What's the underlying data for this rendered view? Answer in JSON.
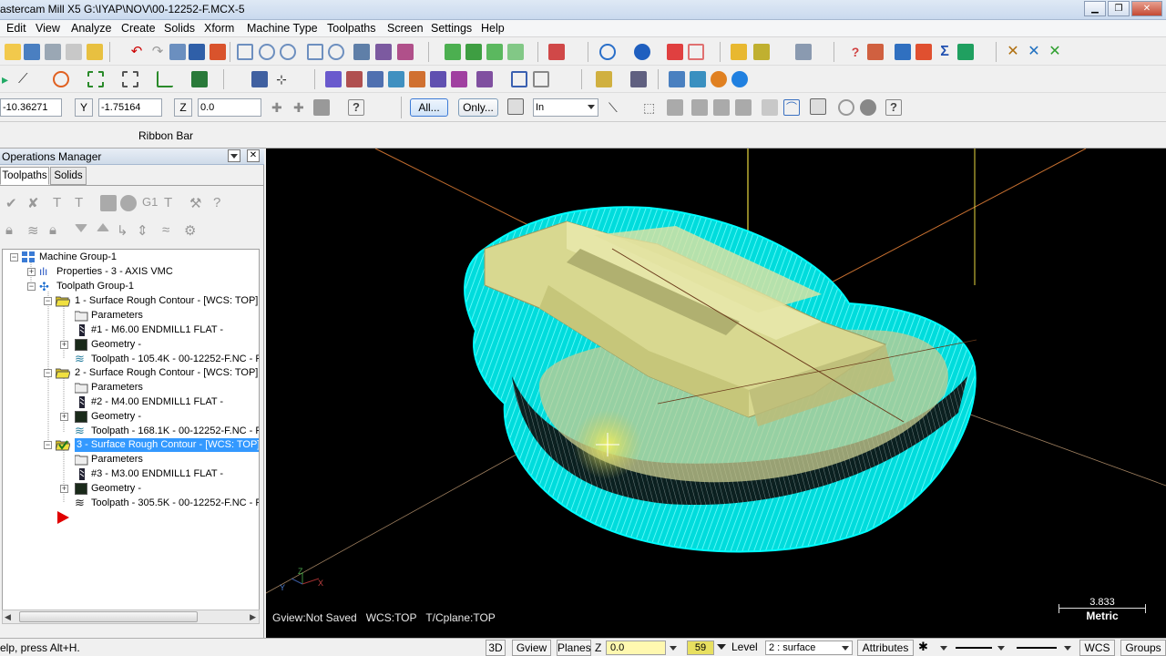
{
  "window": {
    "title": "astercam Mill X5  G:\\IYAP\\NOV\\00-12252-F.MCX-5"
  },
  "menu": [
    "Edit",
    "View",
    "Analyze",
    "Create",
    "Solids",
    "Xform",
    "Machine Type",
    "Toolpaths",
    "Screen",
    "Settings",
    "Help"
  ],
  "autocursor": {
    "x_value": "-10.36271",
    "y_label": "Y",
    "y_value": "-1.75164",
    "z_label": "Z",
    "z_value": "0.0",
    "all_label": "All...",
    "only_label": "Only...",
    "units": "In"
  },
  "ribbon": {
    "label": "Ribbon Bar"
  },
  "ops_manager": {
    "title": "Operations Manager",
    "tabs": [
      "Toolpaths",
      "Solids"
    ],
    "tree": [
      {
        "label": "Machine Group-1"
      },
      {
        "label": "Properties - 3 - AXIS VMC"
      },
      {
        "label": "Toolpath Group-1"
      },
      {
        "label": "1 - Surface Rough Contour - [WCS: TOP] -"
      },
      {
        "label": "Parameters"
      },
      {
        "label": "#1 - M6.00 ENDMILL1 FLAT -"
      },
      {
        "label": "Geometry -"
      },
      {
        "label": "Toolpath - 105.4K - 00-12252-F.NC - P"
      },
      {
        "label": "2 - Surface Rough Contour - [WCS: TOP] -"
      },
      {
        "label": "Parameters"
      },
      {
        "label": "#2 - M4.00 ENDMILL1 FLAT -"
      },
      {
        "label": "Geometry -"
      },
      {
        "label": "Toolpath - 168.1K - 00-12252-F.NC - P"
      },
      {
        "label": "3 - Surface Rough Contour - [WCS: TOP]"
      },
      {
        "label": "Parameters"
      },
      {
        "label": "#3 - M3.00 ENDMILL1 FLAT -"
      },
      {
        "label": "Geometry -"
      },
      {
        "label": "Toolpath - 305.5K - 00-12252-F.NC - P"
      }
    ]
  },
  "viewport": {
    "info": [
      "Gview:Not Saved",
      "WCS:TOP",
      "T/Cplane:TOP"
    ],
    "scale_value": "3.833",
    "scale_units": "Metric",
    "axis_labels": [
      "Y",
      "Z",
      "X"
    ]
  },
  "statusbar": {
    "help": "elp, press Alt+H.",
    "btn_3d": "3D",
    "btn_gview": "Gview",
    "btn_planes": "Planes",
    "z_label": "Z",
    "z_value": "0.0",
    "level_number": "59",
    "level_label": "Level",
    "level_value": "2 : surface",
    "attributes": "Attributes",
    "wcs": "WCS",
    "groups": "Groups"
  },
  "colors": {
    "toolpath": "#00e5e5",
    "part": "#d8d890",
    "selection": "#3399ff",
    "viewport_bg": "#000000"
  }
}
